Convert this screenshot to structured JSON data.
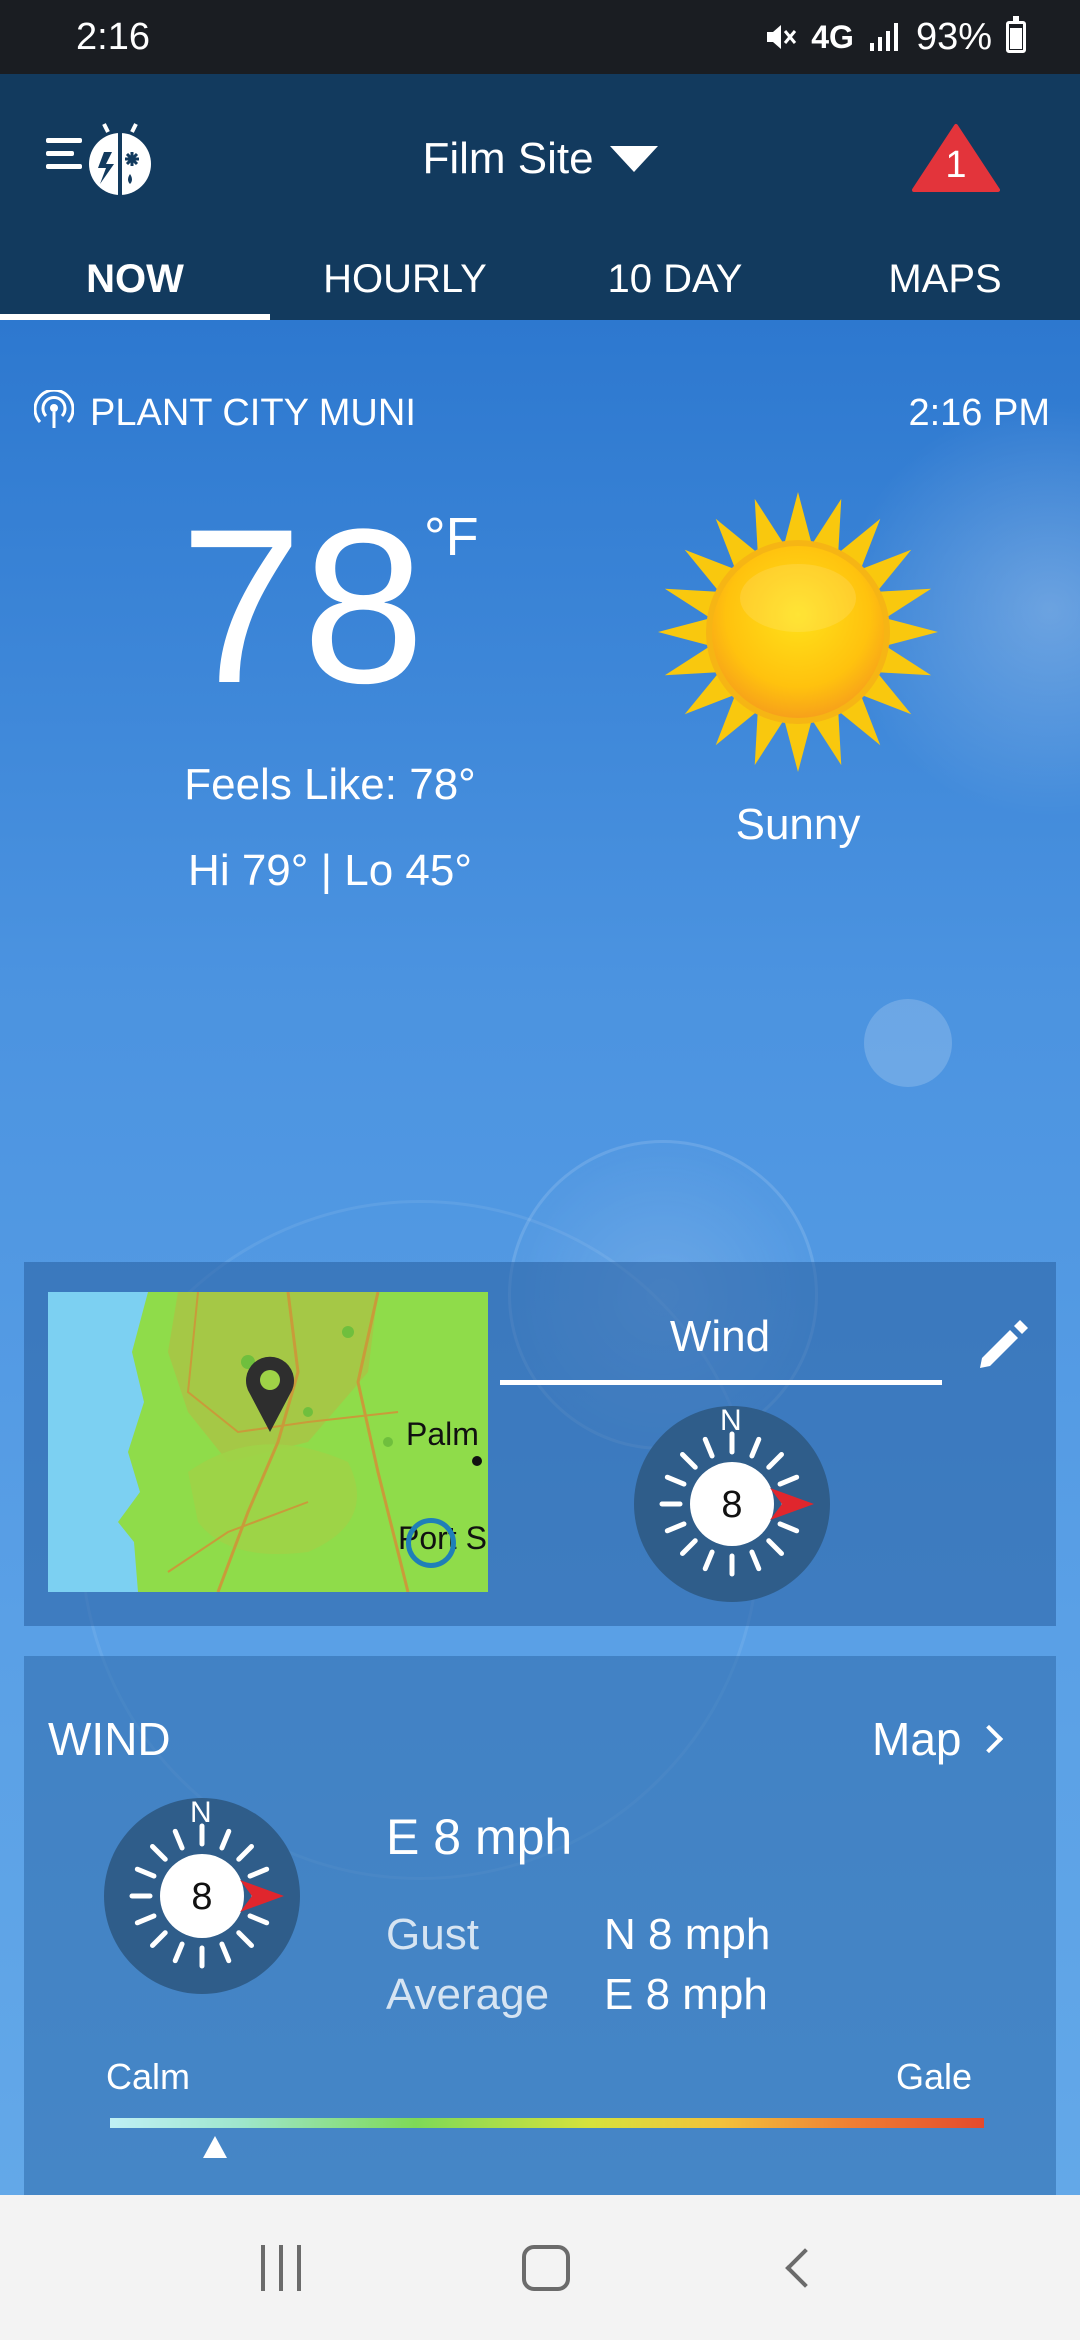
{
  "status_bar": {
    "time": "2:16",
    "network": "4G",
    "battery": "93%"
  },
  "header": {
    "location": "Film Site",
    "alert_count": "1",
    "tabs": [
      {
        "label": "NOW",
        "active": true
      },
      {
        "label": "HOURLY",
        "active": false
      },
      {
        "label": "10 DAY",
        "active": false
      },
      {
        "label": "MAPS",
        "active": false
      }
    ]
  },
  "current": {
    "station": "PLANT CITY MUNI",
    "observed_time": "2:16 PM",
    "temperature": "78",
    "unit": "°F",
    "feels_like": "Feels Like: 78°",
    "hi_lo": "Hi 79° | Lo 45°",
    "condition": "Sunny",
    "condition_icon": "sun-icon"
  },
  "map_card": {
    "labels": [
      "Palm",
      "Port S"
    ],
    "widget_title": "Wind",
    "compass_north": "N",
    "compass_value": "8"
  },
  "wind": {
    "heading": "WIND",
    "map_link": "Map",
    "compass_north": "N",
    "compass_value": "8",
    "speed": "E 8 mph",
    "gust_label": "Gust",
    "gust_value": "N 8 mph",
    "average_label": "Average",
    "average_value": "E 8 mph",
    "scale_low": "Calm",
    "scale_high": "Gale",
    "scale_fraction": 0.12
  },
  "colors": {
    "header": "#123a5e",
    "alert": "#e3343b",
    "needle": "#e0262d"
  }
}
